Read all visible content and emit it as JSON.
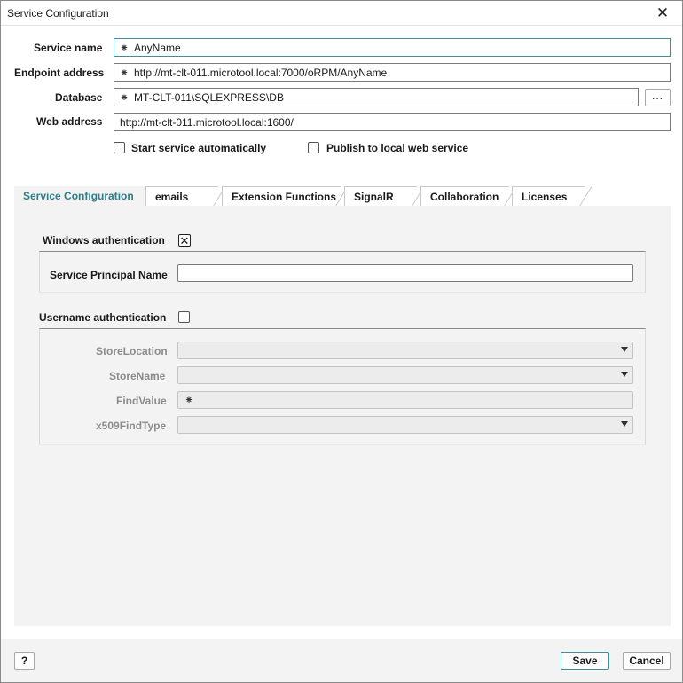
{
  "window": {
    "title": "Service Configuration",
    "close_glyph": "✕"
  },
  "form": {
    "service_name": {
      "label": "Service name",
      "required_marker": "⁕",
      "value": "AnyName"
    },
    "endpoint_address": {
      "label": "Endpoint address",
      "required_marker": "⁕",
      "value": "http://mt-clt-011.microtool.local:7000/oRPM/AnyName"
    },
    "database": {
      "label": "Database",
      "required_marker": "⁕",
      "value": "MT-CLT-011\\SQLEXPRESS\\DB",
      "browse_label": "..."
    },
    "web_address": {
      "label": "Web address",
      "value": "http://mt-clt-011.microtool.local:1600/"
    },
    "start_auto": {
      "label": "Start service automatically",
      "checked": false
    },
    "publish_local": {
      "label": "Publish to local web service",
      "checked": false
    }
  },
  "tabs": [
    {
      "label": "Service Configuration",
      "active": true
    },
    {
      "label": "emails",
      "active": false
    },
    {
      "label": "Extension Functions",
      "active": false
    },
    {
      "label": "SignalR",
      "active": false
    },
    {
      "label": "Collaboration",
      "active": false
    },
    {
      "label": "Licenses",
      "active": false
    }
  ],
  "windows_auth": {
    "label": "Windows authentication",
    "checked": true,
    "check_glyph": "✕",
    "spn_label": "Service Principal Name",
    "spn_value": ""
  },
  "username_auth": {
    "label": "Username authentication",
    "checked": false,
    "store_location_label": "StoreLocation",
    "store_name_label": "StoreName",
    "find_value_label": "FindValue",
    "find_value_marker": "⁕",
    "x509_find_type_label": "x509FindType"
  },
  "footer": {
    "help_label": "?",
    "save_label": "Save",
    "cancel_label": "Cancel"
  },
  "colors": {
    "accent": "#2a7f8a",
    "panel_bg": "#f3f3f3",
    "disabled_text": "#8c8c8c"
  }
}
